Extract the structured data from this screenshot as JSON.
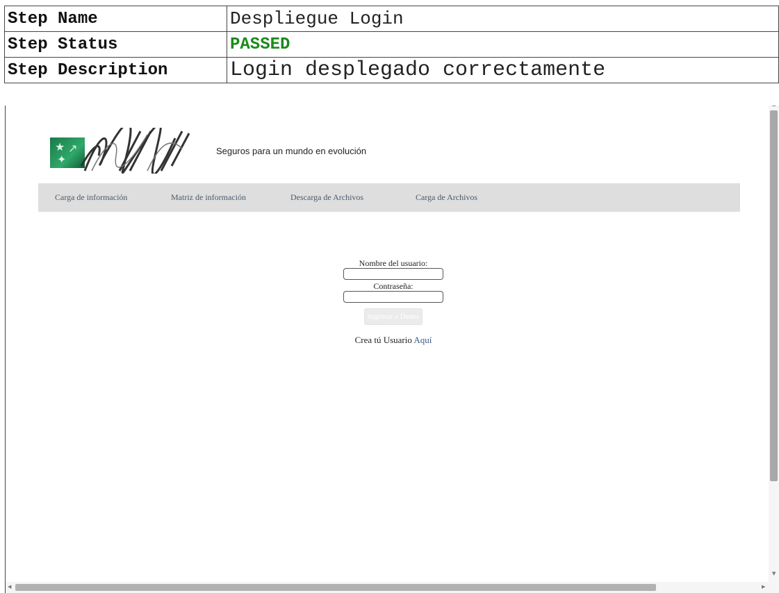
{
  "report": {
    "rows": [
      {
        "key": "Step Name",
        "value": "Despliegue Login"
      },
      {
        "key": "Step Status",
        "value": "PASSED"
      },
      {
        "key": "Step Description",
        "value": "Login desplegado correctamente"
      }
    ]
  },
  "app": {
    "tagline": "Seguros para un mundo en evolución",
    "nav": [
      "Carga de información",
      "Matriz de información",
      "Descarga de Archivos",
      "Carga de Archivos"
    ],
    "login": {
      "user_label": "Nombre del usuario:",
      "password_label": "Contraseña:",
      "submit": "Ingresar a Demo",
      "create_text": "Crea tú Usuario",
      "create_link": "Aquí"
    }
  },
  "colors": {
    "passed": "#1a8a1a",
    "nav_bg": "#dedede",
    "logo_green": "#2fa86a"
  }
}
